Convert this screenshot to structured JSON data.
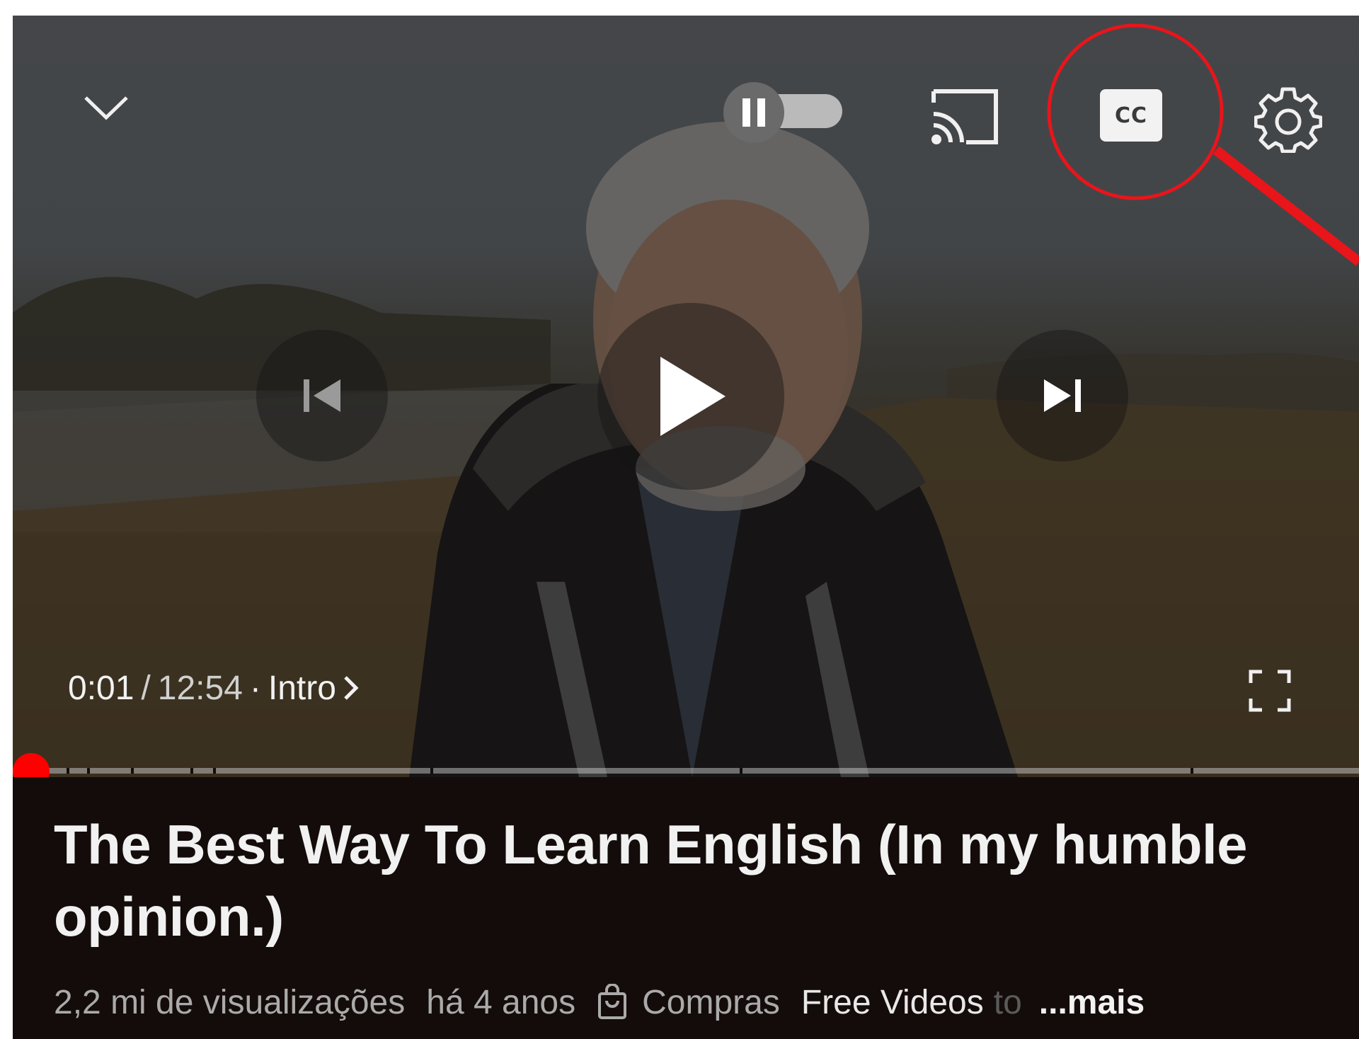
{
  "player": {
    "time_current": "0:01",
    "time_separator": "/",
    "time_duration": "12:54",
    "chapter_dot": "·",
    "chapter_name": "Intro",
    "progress_fraction": 0.0013,
    "chapter_marker_fractions": [
      0.04,
      0.055,
      0.088,
      0.132,
      0.149,
      0.31,
      0.54,
      0.875
    ],
    "cc_label": "CC",
    "autoplay_on": false
  },
  "icons": {
    "collapse": "chevron-down-icon",
    "autoplay": "autoplay-toggle-icon",
    "cast": "cast-icon",
    "captions": "cc-icon",
    "settings": "gear-icon",
    "previous": "skip-previous-icon",
    "play": "play-icon",
    "next": "skip-next-icon",
    "fullscreen": "fullscreen-icon",
    "shopping": "shopping-bag-icon"
  },
  "video": {
    "title": "The Best Way To Learn English (In my humble opinion.)",
    "views": "2,2 mi de visualizações",
    "age": "há 4 anos",
    "shopping_label": "Compras",
    "featured_text_visible": "Free Videos",
    "featured_text_faded": "to",
    "more_label": "...mais"
  },
  "colors": {
    "accent_red": "#ff0000",
    "info_background": "#140c0a",
    "annotation_red": "#e8151b"
  }
}
